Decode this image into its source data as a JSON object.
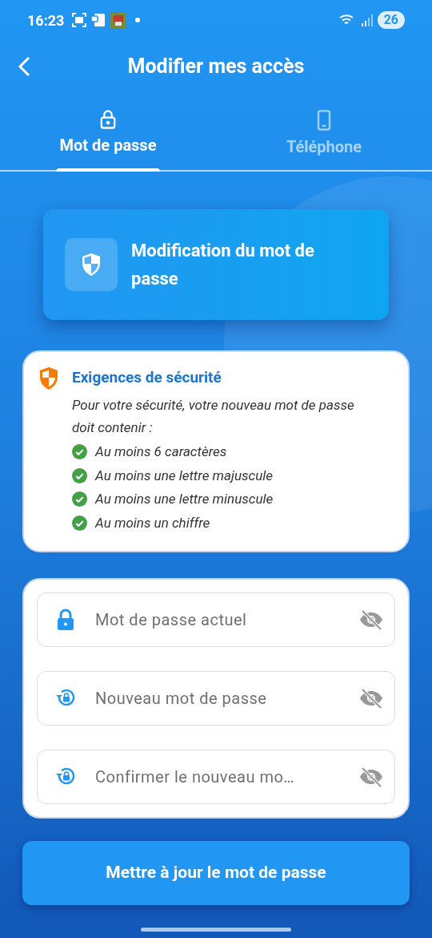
{
  "status_bar": {
    "time": "16:23",
    "battery": "26"
  },
  "header": {
    "title": "Modifier mes accès"
  },
  "tabs": [
    {
      "label": "Mot de passe",
      "kind": "lock",
      "selected": true
    },
    {
      "label": "Téléphone",
      "kind": "phone",
      "selected": false
    }
  ],
  "hero": {
    "title": "Modification du mot de passe"
  },
  "requirements": {
    "title": "Exigences de sécurité",
    "intro": "Pour votre sécurité, votre nouveau mot de passe doit contenir :",
    "items": [
      {
        "text": "Au moins 6 caractères",
        "checked": true
      },
      {
        "text": "Au moins une lettre majuscule",
        "checked": true
      },
      {
        "text": "Au moins une lettre minuscule",
        "checked": true
      },
      {
        "text": "Au moins un chiffre",
        "checked": true
      }
    ]
  },
  "fields": [
    {
      "placeholder": "Mot de passe actuel",
      "kind": "lock"
    },
    {
      "placeholder": "Nouveau mot de passe",
      "kind": "reset"
    },
    {
      "placeholder": "Confirmer le nouveau mo…",
      "kind": "reset"
    }
  ],
  "submit": {
    "label": "Mettre à jour le mot de passe"
  }
}
